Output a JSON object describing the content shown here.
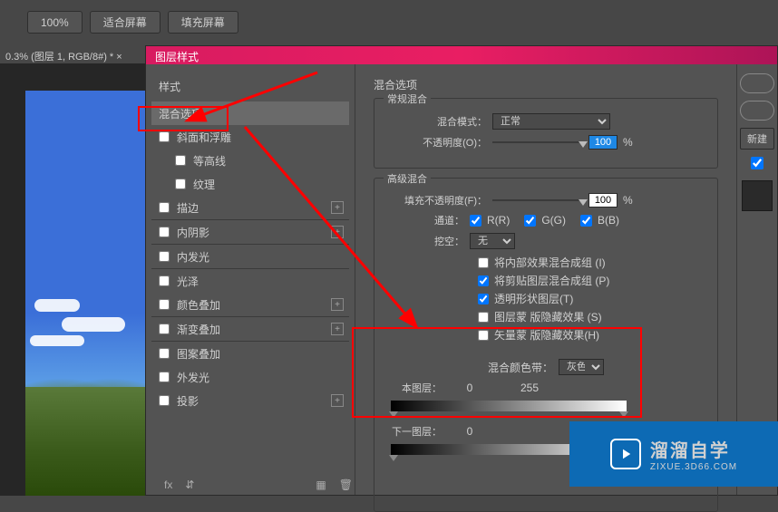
{
  "toolbar": {
    "zoom": "100%",
    "fit": "适合屏幕",
    "fill": "填充屏幕"
  },
  "tab": "0.3% (图层 1, RGB/8#) * ×",
  "dialog": {
    "title": "图层样式"
  },
  "styles_header": "样式",
  "styles": {
    "blend": "混合选项",
    "bevel": "斜面和浮雕",
    "contour": "等高线",
    "texture": "纹理",
    "stroke": "描边",
    "inner_shadow": "内阴影",
    "inner_glow": "内发光",
    "satin": "光泽",
    "color_overlay": "颜色叠加",
    "gradient_overlay": "渐变叠加",
    "pattern_overlay": "图案叠加",
    "outer_glow": "外发光",
    "drop_shadow": "投影"
  },
  "right": {
    "title": "混合选项",
    "general": "常规混合",
    "blend_mode_lbl": "混合模式：",
    "blend_mode_val": "正常",
    "opacity_lbl": "不透明度(O)：",
    "opacity_val": "100",
    "pct": "%",
    "advanced": "高级混合",
    "fill_opacity_lbl": "填充不透明度(F)：",
    "fill_opacity_val": "100",
    "channels_lbl": "通道：",
    "ch_r": "R(R)",
    "ch_g": "G(G)",
    "ch_b": "B(B)",
    "knockout_lbl": "挖空：",
    "knockout_val": "无",
    "c1": "将内部效果混合成组 (I)",
    "c2": "将剪贴图层混合成组 (P)",
    "c3": "透明形状图层(T)",
    "c4": "图层蒙 版隐藏效果 (S)",
    "c5": "矢量蒙 版隐藏效果(H)",
    "blendif_lbl": "混合颜色带：",
    "blendif_val": "灰色",
    "this_layer": "本图层：",
    "this_lo": "0",
    "this_hi": "255",
    "under_layer": "下一图层：",
    "under_lo": "0"
  },
  "far": {
    "btn3": "新建"
  },
  "footer": {
    "fx": "fx"
  },
  "watermark": {
    "name": "溜溜自学",
    "url": "ZIXUE.3D66.COM"
  }
}
